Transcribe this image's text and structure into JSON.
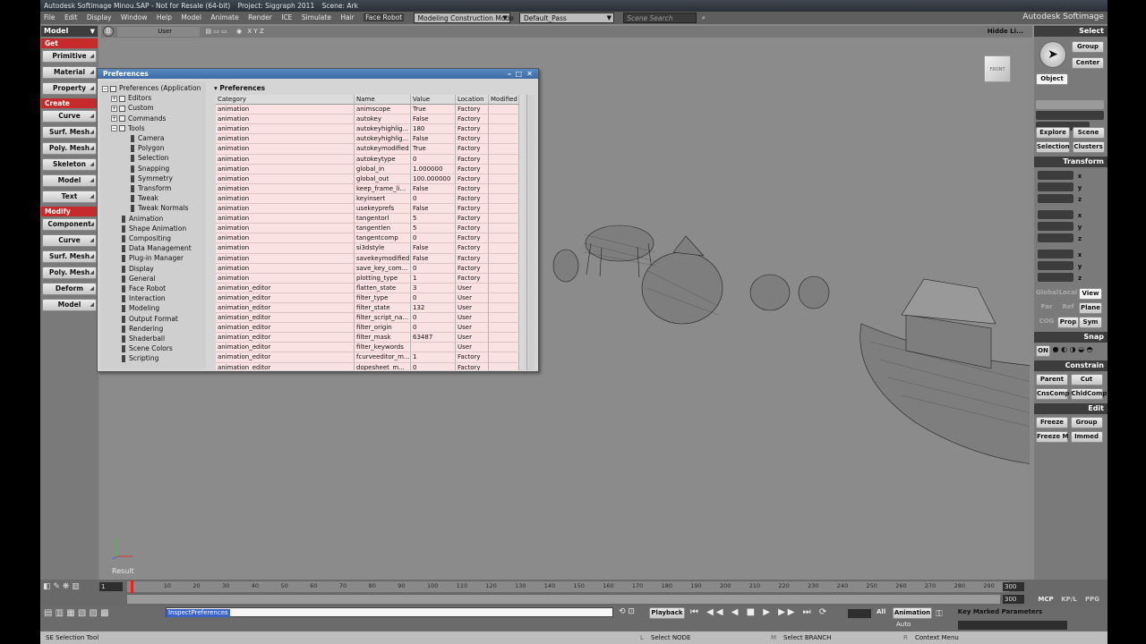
{
  "titlebar": {
    "app": "Autodesk Softimage Minou.SAP - Not for Resale (64-bit)",
    "project": "Project: Siggraph 2011",
    "scene": "Scene: Ark",
    "brand": "Autodesk Softimage"
  },
  "menubar": {
    "items": [
      "File",
      "Edit",
      "Display",
      "Window",
      "Help",
      "Model",
      "Animate",
      "Render",
      "ICE",
      "Simulate",
      "Hair",
      "Face Robot"
    ],
    "construction_mode": "Modeling Construction Mode",
    "pass": "Default_Pass",
    "search_placeholder": "Scene Search"
  },
  "left_toolbar": {
    "header": "Model",
    "get": "Get",
    "get_buttons": [
      "Primitive",
      "Material",
      "Property"
    ],
    "create": "Create",
    "create_buttons": [
      "Curve",
      "Surf. Mesh",
      "Poly. Mesh",
      "Skeleton",
      "Model",
      "Text"
    ],
    "modify": "Modify",
    "modify_buttons": [
      "Component",
      "Curve",
      "Surf. Mesh",
      "Poly. Mesh",
      "Deform",
      "Model"
    ]
  },
  "viewport": {
    "camera_label": "User",
    "axes": "X Y Z",
    "hidden_label": "Hidde Li...",
    "result_label": "Result",
    "cube_label": "FRONT"
  },
  "preferences": {
    "window_title": "Preferences",
    "panel_title": "Preferences",
    "tree": {
      "root": "Preferences (Application",
      "groups": [
        "Editors",
        "Custom",
        "Commands"
      ],
      "tools": "Tools",
      "tool_items": [
        "Camera",
        "Polygon",
        "Selection",
        "Snapping",
        "Symmetry",
        "Transform",
        "Tweak",
        "Tweak Normals"
      ],
      "items": [
        "Animation",
        "Shape Animation",
        "Compositing",
        "Data Management",
        "Plug-in Manager",
        "Display",
        "General",
        "Face Robot",
        "Interaction",
        "Modeling",
        "Output Format",
        "Rendering",
        "Shaderball",
        "Scene Colors",
        "Scripting"
      ]
    },
    "columns": [
      "Category",
      "Name",
      "Value",
      "Location",
      "Modified"
    ],
    "rows": [
      [
        "animation",
        "animscope",
        "True",
        "Factory",
        ""
      ],
      [
        "animation",
        "autokey",
        "False",
        "Factory",
        ""
      ],
      [
        "animation",
        "autokeyhighlig...",
        "180",
        "Factory",
        ""
      ],
      [
        "animation",
        "autokeyhighlig...",
        "False",
        "Factory",
        ""
      ],
      [
        "animation",
        "autokeymodified",
        "True",
        "Factory",
        ""
      ],
      [
        "animation",
        "autokeytype",
        "0",
        "Factory",
        ""
      ],
      [
        "animation",
        "global_in",
        "1.000000",
        "Factory",
        ""
      ],
      [
        "animation",
        "global_out",
        "100.000000",
        "Factory",
        ""
      ],
      [
        "animation",
        "keep_frame_li...",
        "False",
        "Factory",
        ""
      ],
      [
        "animation",
        "keyinsert",
        "0",
        "Factory",
        ""
      ],
      [
        "animation",
        "usekeyprefs",
        "False",
        "Factory",
        ""
      ],
      [
        "animation",
        "tangentorl",
        "5",
        "Factory",
        ""
      ],
      [
        "animation",
        "tangentlen",
        "5",
        "Factory",
        ""
      ],
      [
        "animation",
        "tangentcomp",
        "0",
        "Factory",
        ""
      ],
      [
        "animation",
        "si3dstyle",
        "False",
        "Factory",
        ""
      ],
      [
        "animation",
        "savekeymodified",
        "False",
        "Factory",
        ""
      ],
      [
        "animation",
        "save_key_com...",
        "0",
        "Factory",
        ""
      ],
      [
        "animation",
        "plotting_type",
        "1",
        "Factory",
        ""
      ],
      [
        "animation_editor",
        "flatten_state",
        "3",
        "User",
        ""
      ],
      [
        "animation_editor",
        "filter_type",
        "0",
        "User",
        ""
      ],
      [
        "animation_editor",
        "filter_state",
        "132",
        "User",
        ""
      ],
      [
        "animation_editor",
        "filter_script_na...",
        "0",
        "User",
        ""
      ],
      [
        "animation_editor",
        "filter_origin",
        "0",
        "User",
        ""
      ],
      [
        "animation_editor",
        "filter_mask",
        "63487",
        "User",
        ""
      ],
      [
        "animation_editor",
        "filter_keywords",
        "",
        "User",
        ""
      ],
      [
        "animation_editor",
        "fcurveeditor_m...",
        "1",
        "Factory",
        ""
      ],
      [
        "animation_editor",
        "dopesheet_m...",
        "0",
        "Factory",
        ""
      ]
    ]
  },
  "right_toolbar": {
    "select": "Select",
    "select_buttons": [
      "Group",
      "Center"
    ],
    "object": "Object",
    "explore": "Explore",
    "scene": "Scene",
    "selection": "Selection",
    "clusters": "Clusters",
    "transform": "Transform",
    "axes": [
      "x",
      "y",
      "z"
    ],
    "ref_buttons": [
      "Global",
      "Local",
      "View"
    ],
    "ref2_buttons": [
      "Par",
      "Ref",
      "Plane"
    ],
    "ref3_buttons": [
      "COG",
      "Prop",
      "Sym"
    ],
    "snap": "Snap",
    "snap_on": "ON",
    "constrain": "Constrain",
    "constrain_buttons": [
      "Parent",
      "Cut",
      "CnsComp",
      "ChldComp"
    ],
    "edit": "Edit",
    "edit_buttons": [
      "Freeze",
      "Group",
      "Freeze M",
      "Immed"
    ],
    "bottom_tabs": [
      "MCP",
      "KP/L",
      "PPG"
    ]
  },
  "timeline": {
    "start": "1",
    "end": "300",
    "end2": "300",
    "ticks": [
      "10",
      "20",
      "30",
      "40",
      "50",
      "60",
      "70",
      "80",
      "90",
      "100",
      "110",
      "120",
      "130",
      "140",
      "150",
      "160",
      "170",
      "180",
      "190",
      "200",
      "210",
      "220",
      "230",
      "240",
      "250",
      "260",
      "270",
      "280",
      "290"
    ],
    "playback": "Playback",
    "all": "All",
    "animation": "Animation",
    "auto": "Auto",
    "key_marked": "Key Marked Parameters",
    "command": "InspectPreferences"
  },
  "status": {
    "tool": "SE Selection Tool",
    "l_action": "Select NODE",
    "m_action": "Select BRANCH",
    "r_action": "Context Menu",
    "l": "L",
    "m": "M",
    "r": "R"
  }
}
